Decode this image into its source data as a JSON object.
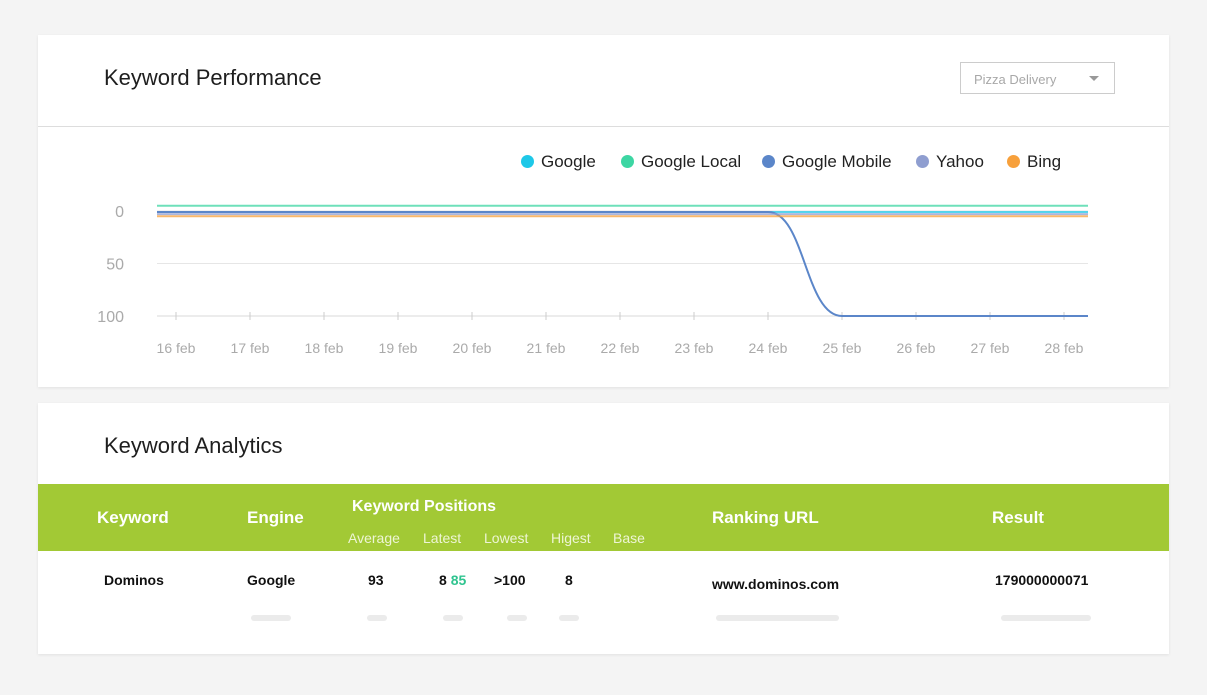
{
  "performance": {
    "title": "Keyword Performance",
    "dropdown": {
      "selected": "Pizza Delivery"
    },
    "chart_data": {
      "type": "line",
      "title": "",
      "xlabel": "",
      "ylabel": "",
      "x": [
        "16 feb",
        "17 feb",
        "18 feb",
        "19 feb",
        "20 feb",
        "21 feb",
        "22 feb",
        "23 feb",
        "24 feb",
        "25 feb",
        "26 feb",
        "27 feb",
        "28 feb"
      ],
      "y_ticks": [
        0,
        50,
        100
      ],
      "ylim": [
        0,
        100
      ],
      "y_inverted": true,
      "grid": true,
      "legend_position": "top-right",
      "series": [
        {
          "name": "Google",
          "color": "#1ec8e8",
          "values": [
            1,
            1,
            1,
            1,
            1,
            1,
            1,
            1,
            1,
            1,
            1,
            1,
            1
          ]
        },
        {
          "name": "Google Local",
          "color": "#3dd6a3",
          "values": [
            -5,
            -5,
            -5,
            -5,
            -5,
            -5,
            -5,
            -5,
            -5,
            -5,
            -5,
            -5,
            -5
          ]
        },
        {
          "name": "Google Mobile",
          "color": "#5b86c9",
          "values": [
            1,
            1,
            1,
            1,
            1,
            1,
            1,
            1,
            1,
            100,
            100,
            100,
            100
          ]
        },
        {
          "name": "Yahoo",
          "color": "#8f9ed0",
          "values": [
            3,
            3,
            3,
            3,
            3,
            3,
            3,
            3,
            3,
            3,
            3,
            3,
            3
          ]
        },
        {
          "name": "Bing",
          "color": "#f7a03b",
          "values": [
            5,
            5,
            5,
            5,
            5,
            5,
            5,
            5,
            5,
            5,
            5,
            5,
            5
          ]
        }
      ]
    }
  },
  "analytics": {
    "title": "Keyword Analytics",
    "headers": {
      "keyword": "Keyword",
      "engine": "Engine",
      "positions": "Keyword Positions",
      "ranking_url": "Ranking URL",
      "result": "Result",
      "sub": {
        "average": "Average",
        "latest": "Latest",
        "lowest": "Lowest",
        "highest": "Higest",
        "base": "Base"
      }
    },
    "row": {
      "keyword": "Dominos",
      "engine": "Google",
      "average": "93",
      "latest": "8",
      "latest_change": "85",
      "lowest": ">100",
      "highest": "8",
      "base": "",
      "ranking_url": "www.dominos.com",
      "result": "179000000071"
    }
  }
}
